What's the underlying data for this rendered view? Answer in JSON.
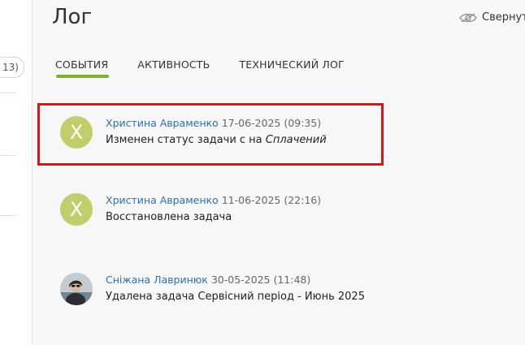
{
  "sidebar": {
    "count_badge": "13)"
  },
  "header": {
    "title": "Лог",
    "collapse_label": "Свернуть"
  },
  "tabs": [
    {
      "label": "СОБЫТИЯ",
      "active": true
    },
    {
      "label": "АКТИВНОСТЬ",
      "active": false
    },
    {
      "label": "ТЕХНИЧЕСКИЙ ЛОГ",
      "active": false
    }
  ],
  "entries": [
    {
      "avatar_letter": "Х",
      "author": "Христина Авраменко",
      "date": "17-06-2025 (09:35)",
      "text": "Изменен статус задачи  с на ",
      "text_em": "Сплачений"
    },
    {
      "avatar_letter": "Х",
      "author": "Христина Авраменко",
      "date": "11-06-2025 (22:16)",
      "text": "Восстановлена задача"
    },
    {
      "avatar_type": "photo",
      "author": "Сніжана Лавринюк",
      "date": "30-05-2025 (11:48)",
      "text": "Удалена задача Сервісний період - Июнь 2025"
    }
  ],
  "colors": {
    "accent_tab": "#7ab32e",
    "link": "#2e6fb0",
    "highlight": "#d5141b",
    "avatar_letter_bg": "#c3cd6c"
  }
}
